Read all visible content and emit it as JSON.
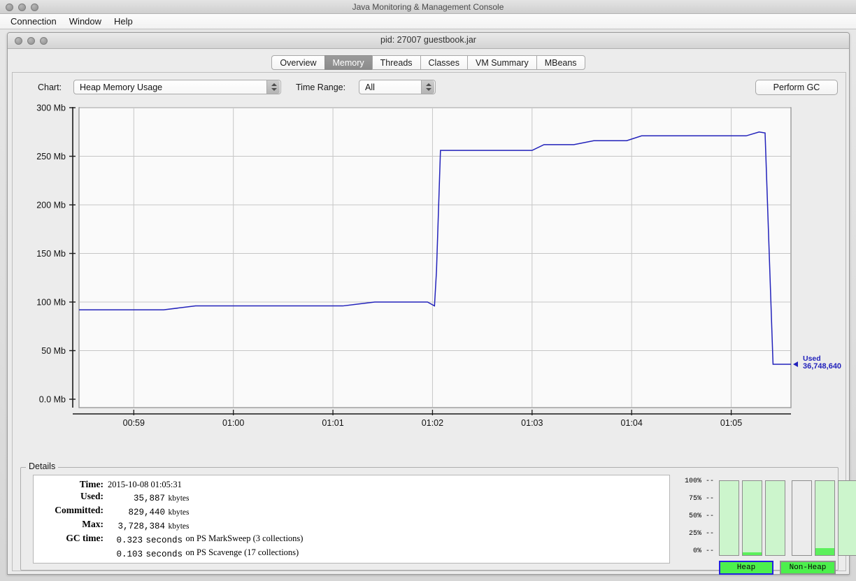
{
  "window": {
    "outer_title": "Java Monitoring & Management Console",
    "inner_title": "pid: 27007 guestbook.jar"
  },
  "menubar": {
    "items": [
      {
        "label": "Connection"
      },
      {
        "label": "Window"
      },
      {
        "label": "Help"
      }
    ]
  },
  "tabs": [
    {
      "label": "Overview",
      "selected": false
    },
    {
      "label": "Memory",
      "selected": true
    },
    {
      "label": "Threads",
      "selected": false
    },
    {
      "label": "Classes",
      "selected": false
    },
    {
      "label": "VM Summary",
      "selected": false
    },
    {
      "label": "MBeans",
      "selected": false
    }
  ],
  "controls": {
    "chart_label": "Chart:",
    "chart_value": "Heap Memory Usage",
    "time_range_label": "Time Range:",
    "time_range_value": "All",
    "perform_gc_label": "Perform GC",
    "connection_icon": "connected-plug-icon"
  },
  "chart_data": {
    "type": "line",
    "title": "Heap Memory Usage",
    "xlabel": "",
    "ylabel": "",
    "grid": true,
    "line_color": "#2222bb",
    "ylim": [
      0,
      300
    ],
    "ytick_labels": [
      "300 Mb",
      "250 Mb",
      "200 Mb",
      "150 Mb",
      "100 Mb",
      "50 Mb",
      "0.0 Mb"
    ],
    "ytick_values": [
      300,
      250,
      200,
      150,
      100,
      50,
      0
    ],
    "xtick_labels": [
      "00:59",
      "01:00",
      "01:01",
      "01:02",
      "01:03",
      "01:04",
      "01:05"
    ],
    "xlim": [
      58.45,
      65.6
    ],
    "series": [
      {
        "name": "Used",
        "x": [
          58.45,
          59.3,
          59.62,
          61.1,
          61.42,
          61.95,
          62.02,
          62.04,
          62.08,
          63.0,
          63.12,
          63.42,
          63.62,
          63.95,
          64.1,
          65.15,
          65.28,
          65.34,
          65.42,
          65.6
        ],
        "y": [
          92,
          92,
          96,
          96,
          100,
          100,
          96,
          132,
          256,
          256,
          262,
          262,
          266,
          266,
          271,
          271,
          275,
          274,
          36,
          36
        ]
      }
    ],
    "annotation": {
      "label": "Used",
      "value": "36,748,640",
      "marker": "left-triangle",
      "color": "#2222bb"
    }
  },
  "details": {
    "legend": "Details",
    "rows": [
      {
        "label": "Time:",
        "value": "2015-10-08 01:05:31",
        "numeric": "",
        "unit": ""
      },
      {
        "label": "Used:",
        "value": "",
        "numeric": "35,887",
        "unit": "kbytes"
      },
      {
        "label": "Committed:",
        "value": "",
        "numeric": "829,440",
        "unit": "kbytes"
      },
      {
        "label": "Max:",
        "value": "",
        "numeric": "3,728,384",
        "unit": "kbytes"
      },
      {
        "label": "GC time:",
        "value": "on PS MarkSweep (3 collections)",
        "numeric": "0.323",
        "unit": "seconds"
      },
      {
        "label": "",
        "value": "on PS Scavenge (17 collections)",
        "numeric": "0.103",
        "unit": "seconds"
      }
    ]
  },
  "pools": {
    "axis_labels": [
      "100% --",
      "75% --",
      "50% --",
      "25% --",
      "0% --"
    ],
    "bars": [
      {
        "group": "heap",
        "light_pct": 100,
        "bright_pct": 0
      },
      {
        "group": "heap",
        "light_pct": 100,
        "bright_pct": 4
      },
      {
        "group": "heap",
        "light_pct": 100,
        "bright_pct": 0
      },
      {
        "group": "nonheap",
        "light_pct": 0,
        "bright_pct": 0
      },
      {
        "group": "nonheap",
        "light_pct": 100,
        "bright_pct": 9
      },
      {
        "group": "nonheap",
        "light_pct": 100,
        "bright_pct": 0
      }
    ],
    "buttons": [
      {
        "label": "Heap",
        "selected": true
      },
      {
        "label": "Non-Heap",
        "selected": false
      }
    ],
    "colors": {
      "light_fill": "#ccf5cc",
      "bright_fill": "#5cf05c",
      "button_fill": "#4cf04c",
      "selected_border": "#2222dd"
    }
  }
}
